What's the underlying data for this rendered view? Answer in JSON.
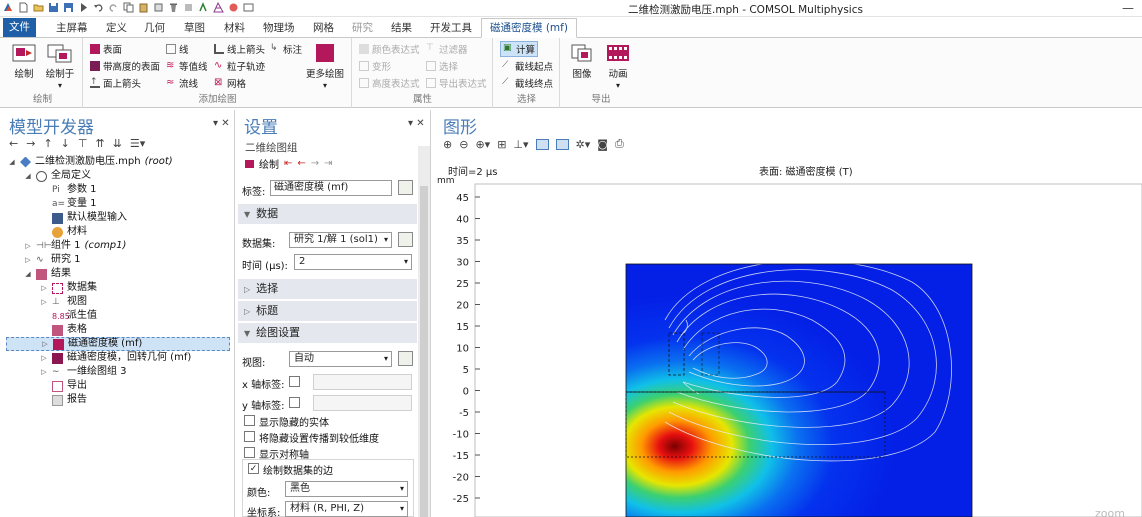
{
  "window": {
    "title": "二维检测激励电压.mph - COMSOL Multiphysics",
    "minimize_glyph": "—"
  },
  "tabs": [
    "文件",
    "主屏幕",
    "定义",
    "几何",
    "草图",
    "材料",
    "物理场",
    "网格",
    "研究",
    "结果",
    "开发工具",
    "磁通密度模 (mf)"
  ],
  "ribbon": {
    "plot": {
      "btn1": "绘制",
      "btn2": "绘制于",
      "group": "绘制"
    },
    "add": {
      "surface": "表面",
      "height_surface": "带高度的表面",
      "surface_arrow": "面上箭头",
      "line": "线",
      "contour": "等值线",
      "streamline": "流线",
      "line_arrow": "线上箭头",
      "particle": "粒子轨迹",
      "mesh": "网格",
      "annotation": "标注",
      "more": "更多绘图",
      "group": "添加绘图"
    },
    "attr": {
      "color_expr": "颜色表达式",
      "deform": "变形",
      "height_expr": "高度表达式",
      "filter": "过滤器",
      "selection": "选择",
      "export_expr": "导出表达式",
      "group": "属性"
    },
    "select": {
      "compute": "计算",
      "start": "截线起点",
      "end": "截线终点",
      "group": "选择"
    },
    "export": {
      "image": "图像",
      "animation": "动画",
      "group": "导出"
    }
  },
  "model_builder": {
    "title": "模型开发器",
    "tree": [
      {
        "label": "二维检测激励电压.mph",
        "suffix": "(root)"
      },
      {
        "label": "全局定义",
        "suffix": ""
      },
      {
        "label": "参数 1",
        "suffix": ""
      },
      {
        "label": "变量 1",
        "suffix": ""
      },
      {
        "label": "默认模型输入",
        "suffix": ""
      },
      {
        "label": "材料",
        "suffix": ""
      },
      {
        "label": "组件 1",
        "suffix": "(comp1)"
      },
      {
        "label": "研究 1",
        "suffix": ""
      },
      {
        "label": "结果",
        "suffix": ""
      },
      {
        "label": "数据集",
        "suffix": ""
      },
      {
        "label": "视图",
        "suffix": ""
      },
      {
        "label": "派生值",
        "suffix": ""
      },
      {
        "label": "表格",
        "suffix": ""
      },
      {
        "label": "磁通密度模 (mf)",
        "suffix": ""
      },
      {
        "label": "磁通密度模，回转几何 (mf)",
        "suffix": ""
      },
      {
        "label": "一维绘图组 3",
        "suffix": ""
      },
      {
        "label": "导出",
        "suffix": ""
      },
      {
        "label": "报告",
        "suffix": ""
      }
    ]
  },
  "settings": {
    "title": "设置",
    "subtitle": "二维绘图组",
    "plot_btn": "绘制",
    "label_caption": "标签:",
    "label_value": "磁通密度模 (mf)",
    "section_data": "数据",
    "dataset_caption": "数据集:",
    "dataset_value": "研究 1/解 1 (sol1)",
    "time_caption": "时间 (µs):",
    "time_value": "2",
    "section_selection": "选择",
    "section_title": "标题",
    "section_plot_settings": "绘图设置",
    "view_caption": "视图:",
    "view_value": "自动",
    "xlabel_caption": "x 轴标签:",
    "ylabel_caption": "y 轴标签:",
    "cb_hidden": "显示隐藏的实体",
    "cb_propagate": "将隐藏设置传播到较低维度",
    "cb_symmetry": "显示对称轴",
    "cb_edges": "绘制数据集的边",
    "color_caption": "颜色:",
    "color_value": "黑色",
    "coord_caption": "坐标系:",
    "coord_value": "材料 (R, PHI, Z)"
  },
  "graphics": {
    "title": "图形",
    "time_label": "时间=2 µs",
    "surface_label": "表面: 磁通密度模 (T)",
    "unit": "mm",
    "yticks": [
      "45",
      "40",
      "35",
      "30",
      "25",
      "20",
      "15",
      "10",
      "5",
      "0",
      "-5",
      "-10",
      "-15",
      "-20",
      "-25"
    ],
    "watermark": "zoom"
  }
}
